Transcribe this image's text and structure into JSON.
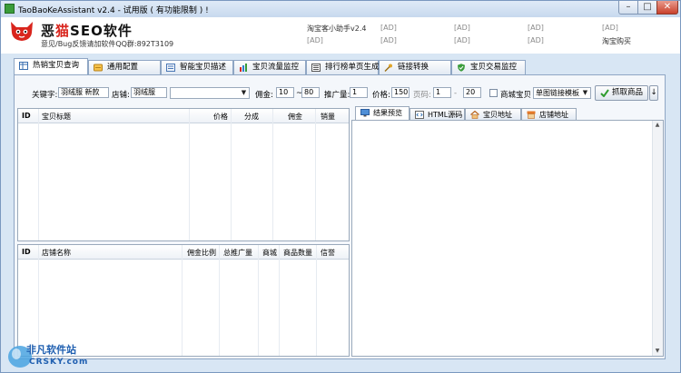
{
  "window": {
    "title": "TaoBaoKeAssistant v2.4 - 试用版 ( 有功能限制 ) !",
    "buttons": {
      "minimize": "–",
      "maximize": "□",
      "close": "✕"
    }
  },
  "header": {
    "logo_dark": "恶",
    "logo_red": "猫",
    "logo_rest": "SEO软件",
    "subtitle": "意见/Bug反馈请加软件QQ群:892T3109",
    "ads": [
      [
        "淘宝客小助手v2.4",
        "[AD]",
        "[AD]",
        "[AD]",
        "[AD]"
      ],
      [
        "[AD]",
        "[AD]",
        "[AD]",
        "[AD]",
        "淘宝购买"
      ]
    ]
  },
  "tabs": [
    {
      "label": "热销宝贝查询",
      "icon": "table-icon",
      "active": true
    },
    {
      "label": "通用配置",
      "icon": "settings-icon",
      "active": false
    },
    {
      "label": "智能宝贝描述",
      "icon": "document-icon",
      "active": false
    },
    {
      "label": "宝贝流量监控",
      "icon": "bar-chart-icon",
      "active": false
    },
    {
      "label": "排行榜单页生成",
      "icon": "list-page-icon",
      "active": false
    },
    {
      "label": "链接转换",
      "icon": "key-icon",
      "active": false
    },
    {
      "label": "宝贝交易监控",
      "icon": "shield-icon",
      "active": false
    }
  ],
  "search": {
    "keyword_label": "关键字:",
    "keyword_value": "羽绒服 新款",
    "shop_label": "店铺:",
    "shop_value": "羽绒服",
    "category_value": "",
    "commission_label": "佣金:",
    "commission_min": "10",
    "commission_sep": "~",
    "commission_max": "80",
    "promo_label": "推广量:",
    "promo_value": "1",
    "price_label": "价格:",
    "price_value": "150",
    "page_label": "页码:",
    "page_from": "1",
    "page_sep": "-",
    "page_to": "20",
    "mall_label": "商城宝贝",
    "template_value": "单图链接模板",
    "fetch_label": "抓取商品"
  },
  "products_table": {
    "columns": [
      "ID",
      "宝贝标题",
      "价格",
      "分成",
      "佣金",
      "销量"
    ],
    "rows": []
  },
  "shops_table": {
    "columns": [
      "ID",
      "店铺名称",
      "佣金比例",
      "总推广量",
      "商城",
      "商品数量",
      "信誉"
    ],
    "rows": []
  },
  "result_tabs": [
    {
      "label": "结果预览",
      "icon": "monitor-icon",
      "active": true
    },
    {
      "label": "HTML源码",
      "icon": "code-icon",
      "active": false
    },
    {
      "label": "宝贝地址",
      "icon": "home-icon",
      "active": false
    },
    {
      "label": "店铺地址",
      "icon": "store-icon",
      "active": false
    }
  ],
  "watermark": {
    "name": "非凡软件站",
    "domain": "CRSKY.com"
  },
  "colors": {
    "brand_red": "#d9251d",
    "window_bg": "#d8e6f4",
    "watermark_blue": "#1f5fb0"
  }
}
